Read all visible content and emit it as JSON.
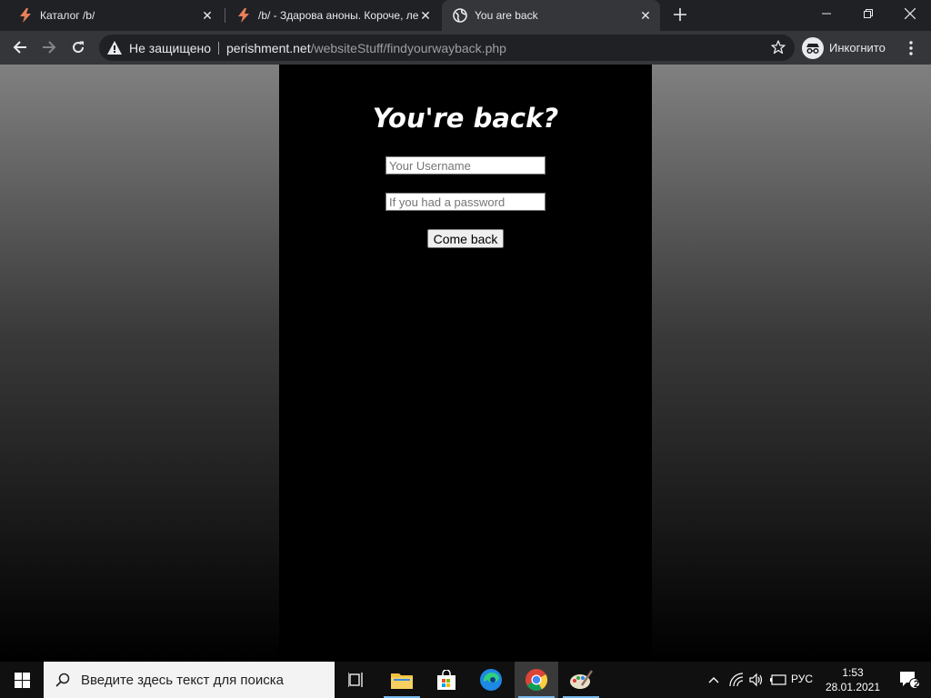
{
  "browser": {
    "tabs": [
      {
        "title": "Каталог /b/",
        "favicon": "lightning-icon",
        "active": false
      },
      {
        "title": "/b/ - Здарова аноны. Короче, ле",
        "favicon": "lightning-icon",
        "active": false
      },
      {
        "title": "You are back",
        "favicon": "globe-icon",
        "active": true
      }
    ],
    "new_tab_icon": "plus-icon",
    "window_controls": [
      "minimize-icon",
      "restore-icon",
      "close-icon"
    ],
    "omnibox": {
      "security_label": "Не защищено",
      "url_host": "perishment.net",
      "url_path": "/websiteStuff/findyourwayback.php"
    },
    "incognito_label": "Инкогнито",
    "colors": {
      "tabstrip": "#202124",
      "toolbar": "#35363a",
      "omnibox": "#202124",
      "text": "#e8eaed"
    }
  },
  "page": {
    "heading": "You're back?",
    "username_placeholder": "Your Username",
    "password_placeholder": "If you had a password",
    "submit_label": "Come back",
    "colors": {
      "panel": "#000000",
      "heading": "#ffffff"
    }
  },
  "taskbar": {
    "search_placeholder": "Введите здесь текст для поиска",
    "apps": [
      "task-view-icon",
      "file-explorer-icon",
      "store-icon",
      "edge-icon",
      "chrome-icon",
      "paint-icon"
    ],
    "language": "РУС",
    "time": "1:53",
    "date": "28.01.2021",
    "notification_count": "2"
  }
}
